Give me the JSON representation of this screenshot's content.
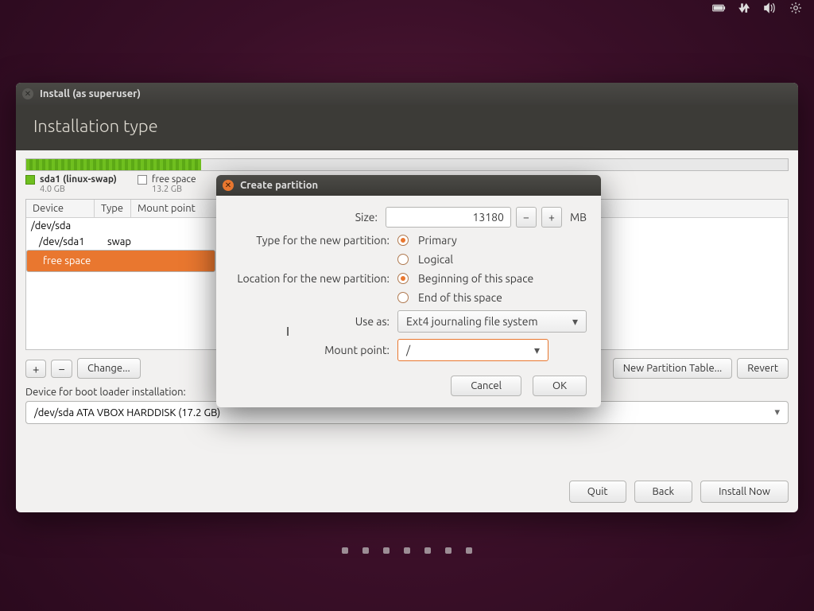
{
  "tray_icons": [
    "battery-icon",
    "network-icon",
    "volume-icon",
    "gear-icon"
  ],
  "installer": {
    "title": "Install (as superuser)",
    "heading": "Installation type",
    "legend": [
      {
        "label": "sda1 (linux-swap)",
        "size": "4.0 GB",
        "swatch": "g"
      },
      {
        "label": "free space",
        "size": "13.2 GB",
        "swatch": "w"
      }
    ],
    "columns": [
      "Device",
      "Type",
      "Mount point"
    ],
    "rows": [
      {
        "device": "/dev/sda",
        "type": "",
        "selected": false,
        "indent": 0
      },
      {
        "device": "/dev/sda1",
        "type": "swap",
        "selected": false,
        "indent": 1
      },
      {
        "device": "free space",
        "type": "",
        "selected": true,
        "indent": 1
      }
    ],
    "buttons": {
      "add": "+",
      "remove": "−",
      "change": "Change...",
      "newtable": "New Partition Table...",
      "revert": "Revert"
    },
    "boot_label": "Device for boot loader installation:",
    "boot_value": "/dev/sda ATA VBOX HARDDISK (17.2 GB)",
    "footer": {
      "quit": "Quit",
      "back": "Back",
      "install": "Install Now"
    }
  },
  "dialog": {
    "title": "Create partition",
    "size_label": "Size:",
    "size_value": "13180",
    "size_unit": "MB",
    "type_label": "Type for the new partition:",
    "type_options": {
      "primary": "Primary",
      "logical": "Logical"
    },
    "type_selected": "primary",
    "loc_label": "Location for the new partition:",
    "loc_options": {
      "begin": "Beginning of this space",
      "end": "End of this space"
    },
    "loc_selected": "begin",
    "useas_label": "Use as:",
    "useas_value": "Ext4 journaling file system",
    "mount_label": "Mount point:",
    "mount_value": "/",
    "cancel": "Cancel",
    "ok": "OK"
  }
}
